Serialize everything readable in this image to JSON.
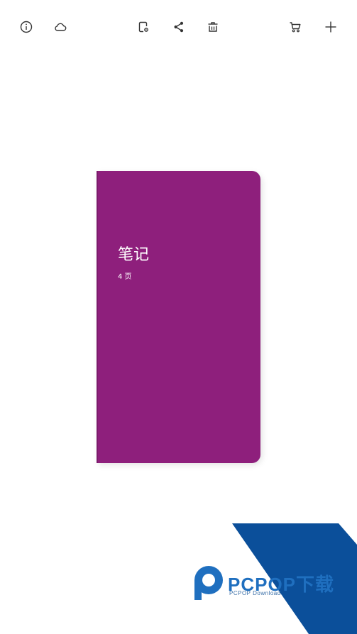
{
  "toolbar": {
    "icons": {
      "info": "info-circle-icon",
      "cloud": "cloud-icon",
      "notebook_settings": "notebook-settings-icon",
      "share": "share-icon",
      "delete": "trash-icon",
      "cart": "cart-icon",
      "add": "plus-icon"
    }
  },
  "notebook": {
    "title": "笔记",
    "pages": "4 页",
    "color": "#8e1f7c"
  },
  "watermark": {
    "text": "PCPOP下载",
    "subtext": "PCPOP Download",
    "colors": {
      "dark_blue": "#0b4f9a",
      "light_blue": "#1f6fbf"
    }
  }
}
